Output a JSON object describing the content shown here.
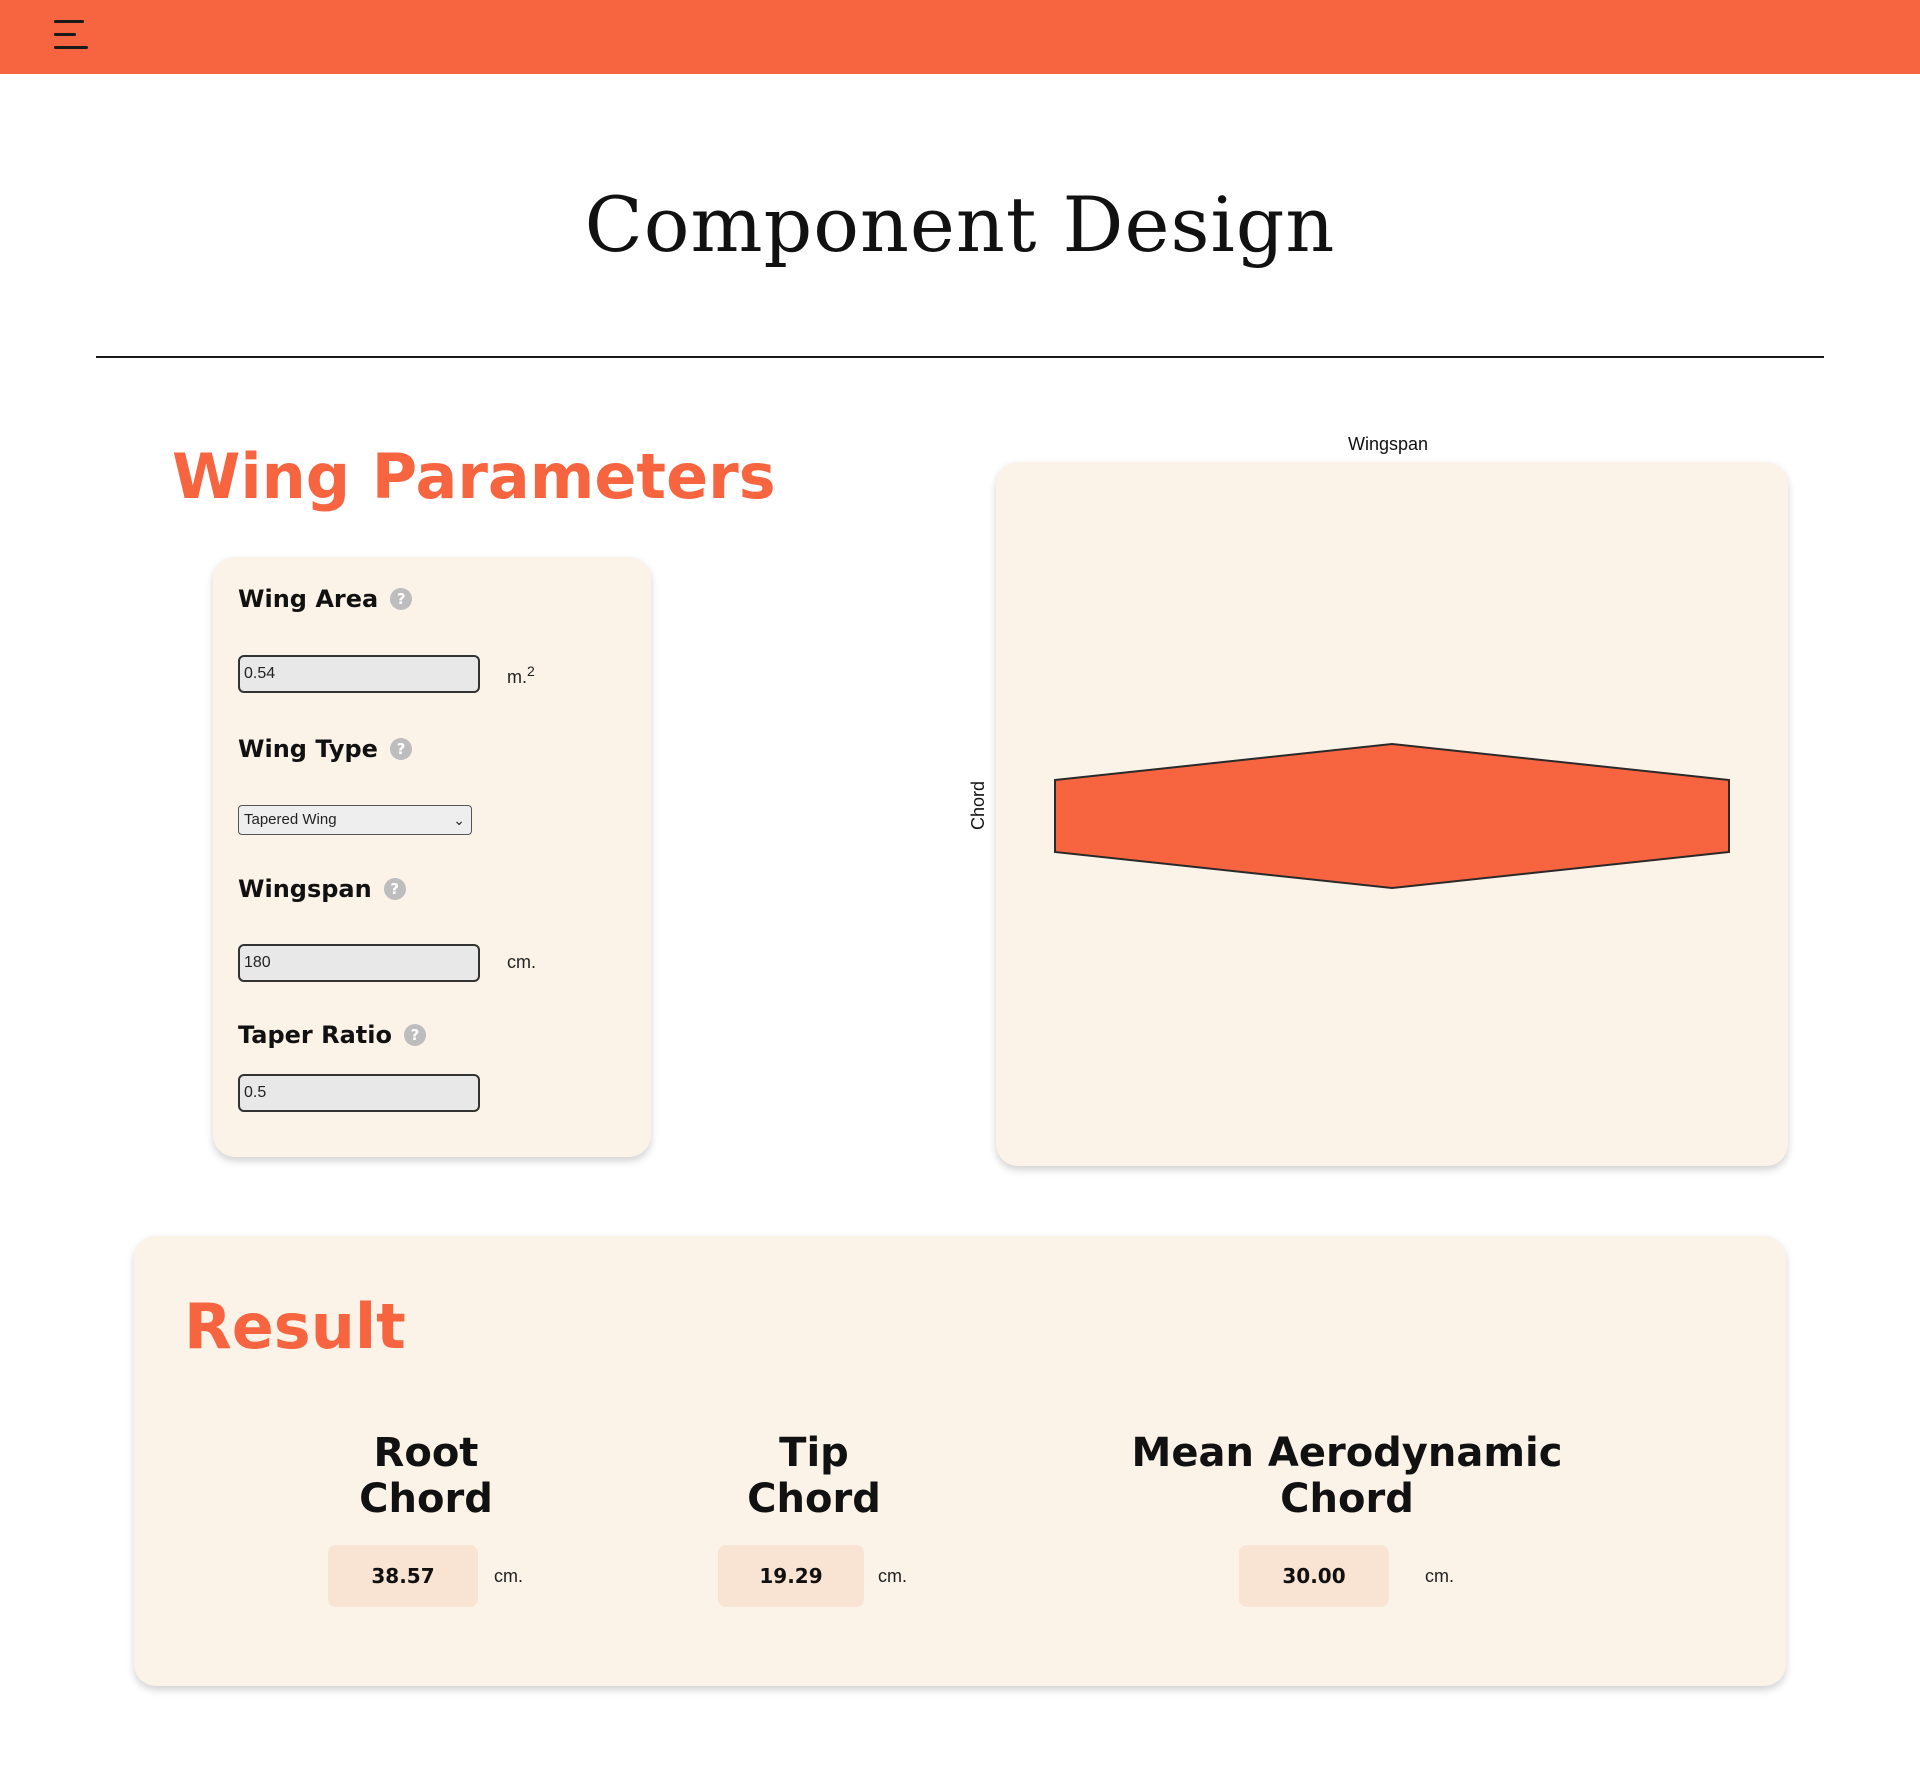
{
  "header": {
    "menu_icon": "hamburger-menu-icon",
    "accent_color": "#f76440"
  },
  "page": {
    "title": "Component Design"
  },
  "wing_parameters": {
    "title": "Wing Parameters",
    "wing_area": {
      "label": "Wing Area",
      "value": "0.54",
      "unit": "m.",
      "unit_sup": "2"
    },
    "wing_type": {
      "label": "Wing Type",
      "selected": "Tapered Wing"
    },
    "wingspan": {
      "label": "Wingspan",
      "value": "180",
      "unit": "cm."
    },
    "taper_ratio": {
      "label": "Taper Ratio",
      "value": "0.5"
    },
    "help_icon": "question-mark-icon"
  },
  "chart_data": {
    "type": "area",
    "title": "Wingspan",
    "xlabel": "Wingspan",
    "ylabel": "Chord",
    "outline": {
      "x": [
        -90,
        0,
        90,
        90,
        0,
        -90
      ],
      "y": [
        9.64,
        19.29,
        9.64,
        -9.64,
        -19.29,
        -9.64
      ]
    },
    "fill_color": "#f76440",
    "grid": false
  },
  "result": {
    "title": "Result",
    "root_chord": {
      "label": "Root Chord",
      "value": "38.57",
      "unit": "cm."
    },
    "tip_chord": {
      "label": "Tip Chord",
      "value": "19.29",
      "unit": "cm."
    },
    "mac": {
      "label": "Mean Aerodynamic Chord",
      "value": "30.00",
      "unit": "cm."
    }
  }
}
